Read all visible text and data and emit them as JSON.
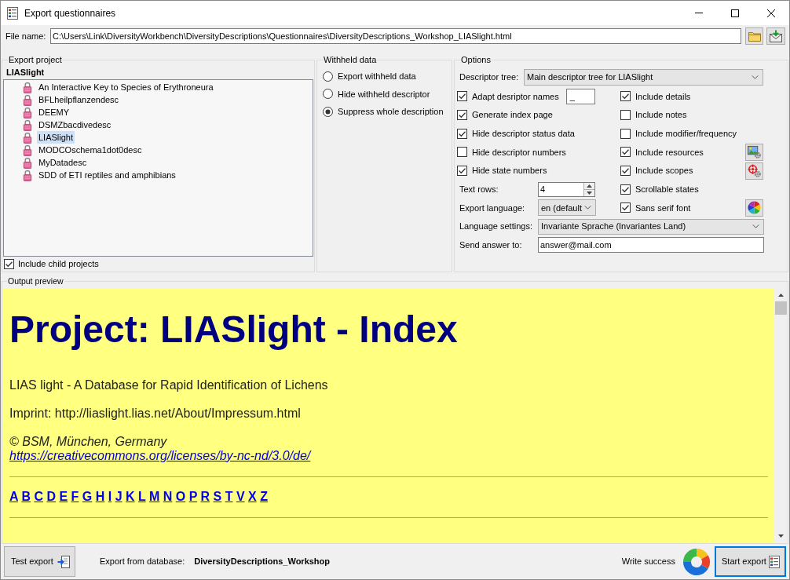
{
  "window": {
    "title": "Export questionnaires"
  },
  "file_name": {
    "label": "File name:",
    "value": "C:\\Users\\Link\\DiversityWorkbench\\DiversityDescriptions\\Questionnaires\\DiversityDescriptions_Workshop_LIASlight.html"
  },
  "export_project": {
    "title": "Export project",
    "current": "LIASlight",
    "items": [
      {
        "label": "An Interactive Key to Species of Erythroneura",
        "selected": false
      },
      {
        "label": "BFLheilpflanzendesc",
        "selected": false
      },
      {
        "label": "DEEMY",
        "selected": false
      },
      {
        "label": "DSMZbacdivedesc",
        "selected": false
      },
      {
        "label": "LIASlight",
        "selected": true
      },
      {
        "label": "MODCOschema1dot0desc",
        "selected": false
      },
      {
        "label": "MyDatadesc",
        "selected": false
      },
      {
        "label": "SDD of ETI reptiles and amphibians",
        "selected": false
      }
    ],
    "include_child_projects": {
      "label": "Include child projects",
      "checked": true
    }
  },
  "withheld_data": {
    "title": "Withheld data",
    "options": [
      {
        "label": "Export withheld data",
        "selected": false
      },
      {
        "label": "Hide withheld descriptor",
        "selected": false
      },
      {
        "label": "Suppress whole description",
        "selected": true
      }
    ]
  },
  "options": {
    "title": "Options",
    "descriptor_tree": {
      "label": "Descriptor tree:",
      "value": "Main descriptor tree for LIASlight"
    },
    "left_checks": [
      {
        "kind": "with_field",
        "label": "Adapt desriptor names",
        "checked": true,
        "value": "_"
      },
      {
        "kind": "plain",
        "label": "Generate index page",
        "checked": true
      },
      {
        "kind": "plain",
        "label": "Hide descriptor status data",
        "checked": true
      },
      {
        "kind": "plain",
        "label": "Hide descriptor numbers",
        "checked": false
      },
      {
        "kind": "plain",
        "label": "Hide state numbers",
        "checked": true
      }
    ],
    "text_rows": {
      "label": "Text rows:",
      "value": "4"
    },
    "export_language": {
      "label": "Export language:",
      "value": "en (default"
    },
    "right_checks": [
      {
        "kind": "plain",
        "label": "Include details",
        "checked": true
      },
      {
        "kind": "plain",
        "label": "Include notes",
        "checked": false
      },
      {
        "kind": "plain",
        "label": "Include modifier/frequency",
        "checked": false
      },
      {
        "kind": "with_button",
        "label": "Include resources",
        "checked": true
      },
      {
        "kind": "with_button",
        "label": "Include scopes",
        "checked": true
      },
      {
        "kind": "plain",
        "label": "Scrollable states",
        "checked": true
      },
      {
        "kind": "with_button",
        "label": "Sans serif font",
        "checked": true
      }
    ],
    "language_settings": {
      "label": "Language settings:",
      "value": "Invariante Sprache (Invariantes Land)"
    },
    "send_answer_to": {
      "label": "Send answer to:",
      "value": "answer@mail.com"
    }
  },
  "output_preview": {
    "title": "Output preview",
    "heading": "Project: LIASlight - Index",
    "lines": [
      "LIAS light - A Database for Rapid Identification of Lichens",
      "Imprint: http://liaslight.lias.net/About/Impressum.html"
    ],
    "copyright": "© BSM, München, Germany",
    "license_link": "https://creativecommons.org/licenses/by-nc-nd/3.0/de/",
    "letters": [
      "A",
      "B",
      "C",
      "D",
      "E",
      "F",
      "G",
      "H",
      "I",
      "J",
      "K",
      "L",
      "M",
      "N",
      "O",
      "P",
      "R",
      "S",
      "T",
      "V",
      "X",
      "Z"
    ]
  },
  "bottom_bar": {
    "test_export": "Test export",
    "database_label": "Export from database:",
    "database": "DiversityDescriptions_Workshop",
    "write_success": "Write success",
    "start_export": "Start export"
  }
}
